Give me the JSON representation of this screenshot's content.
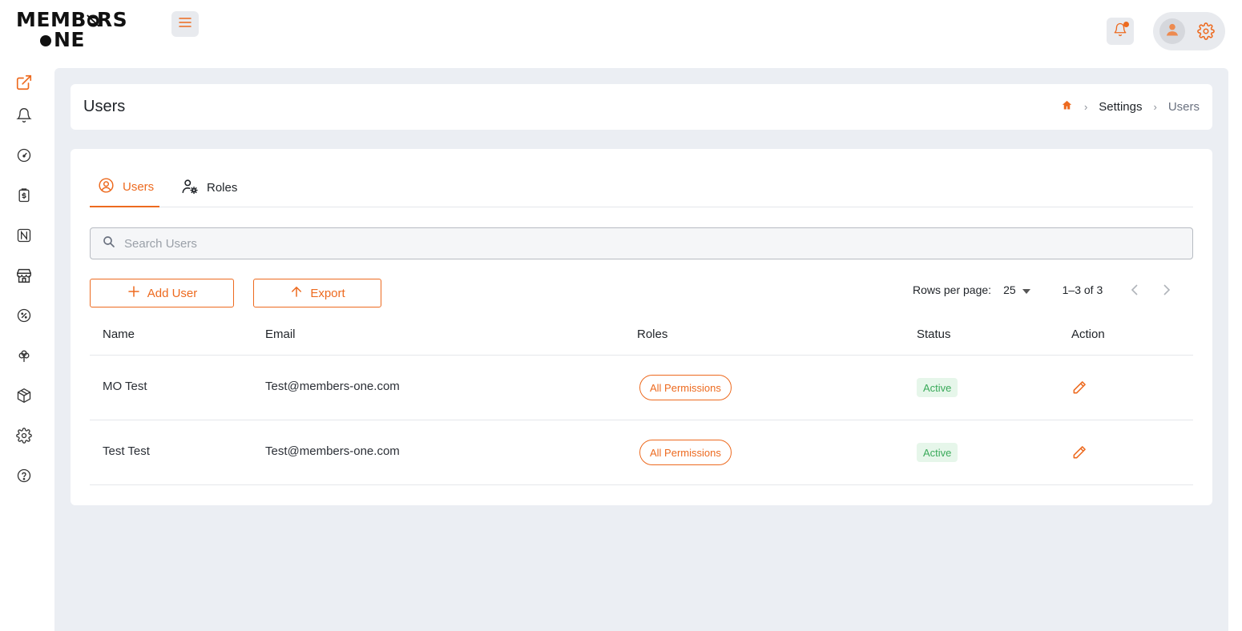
{
  "app": {
    "logo_line1": "MEMB RS",
    "logo_line2": "NE",
    "accent_color": "#ed6a1f",
    "background_color": "#ebeef3"
  },
  "topbar": {
    "menu_icon": "hamburger-icon",
    "notification_icon": "bell-icon",
    "avatar_icon": "user-icon",
    "settings_icon": "gear-icon"
  },
  "sidebar": {
    "items": [
      {
        "icon": "external-link-icon"
      },
      {
        "icon": "bell-icon"
      },
      {
        "icon": "gauge-icon"
      },
      {
        "icon": "receipt-dollar-icon"
      },
      {
        "icon": "id-card-icon"
      },
      {
        "icon": "store-icon"
      },
      {
        "icon": "discount-icon"
      },
      {
        "icon": "clover-icon"
      },
      {
        "icon": "package-icon"
      },
      {
        "icon": "gear-icon"
      },
      {
        "icon": "help-icon"
      }
    ]
  },
  "header": {
    "title": "Users",
    "breadcrumb": [
      "Settings",
      "Users"
    ]
  },
  "tabs": [
    {
      "label": "Users",
      "icon": "user-circle-icon",
      "active": true
    },
    {
      "label": "Roles",
      "icon": "user-gear-icon",
      "active": false
    }
  ],
  "search": {
    "placeholder": "Search Users",
    "value": ""
  },
  "toolbar": {
    "add_label": "Add User",
    "export_label": "Export",
    "rows_per_page_label": "Rows per page:",
    "rows_per_page_value": "25",
    "range_label": "1–3 of 3"
  },
  "table": {
    "columns": [
      "Name",
      "Email",
      "Roles",
      "Status",
      "Action"
    ],
    "rows": [
      {
        "name": "MO Test",
        "email": "Test@members-one.com",
        "role": "All Permissions",
        "status": "Active"
      },
      {
        "name": "Test Test",
        "email": "Test@members-one.com",
        "role": "All Permissions",
        "status": "Active"
      }
    ]
  }
}
